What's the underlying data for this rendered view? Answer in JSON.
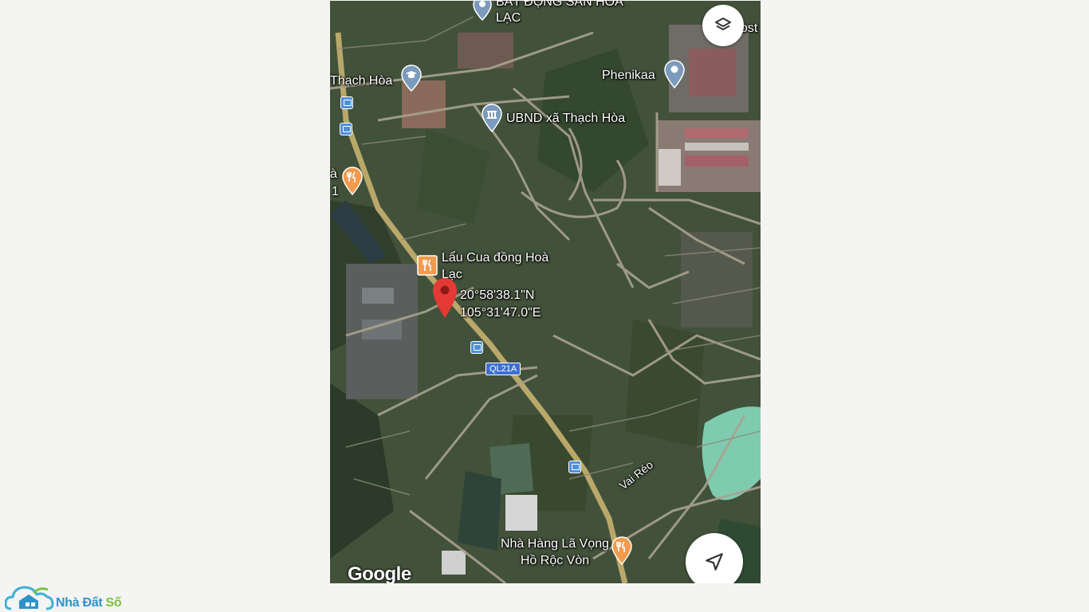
{
  "map": {
    "attribution": "Google",
    "labels": {
      "top_poi": "BẤT ĐỘNG SẢN HOÀ LẠC",
      "thach_hoa": "Thạch Hòa",
      "phenikaa": "Phenikaa",
      "ubnd": "UBND xã Thạch Hòa",
      "lau_cua": "Lẩu Cua đồng Hoà Lạc",
      "road_ql21a": "QL21A",
      "vai_reo": "Vai Réo",
      "nha_hang": "Nhà Hàng Lã Vọng Hồ Rộc Vòn",
      "edge_left_top": "à",
      "edge_left_num": "1",
      "edge_right_top": "ost"
    },
    "pin": {
      "latitude": "20°58'38.1\"N",
      "longitude": "105°31'47.0\"E",
      "color": "#e53935"
    }
  },
  "watermark": {
    "name": "Nhà Đất Số",
    "part1": "Nhà Đất",
    "part2": "Số"
  },
  "colors": {
    "pin_red": "#e53935",
    "food_orange": "#f29a4d",
    "poi_blue": "#7b9bbd",
    "bus_blue": "#4f8fd8",
    "lake": "#7fcbb0"
  }
}
